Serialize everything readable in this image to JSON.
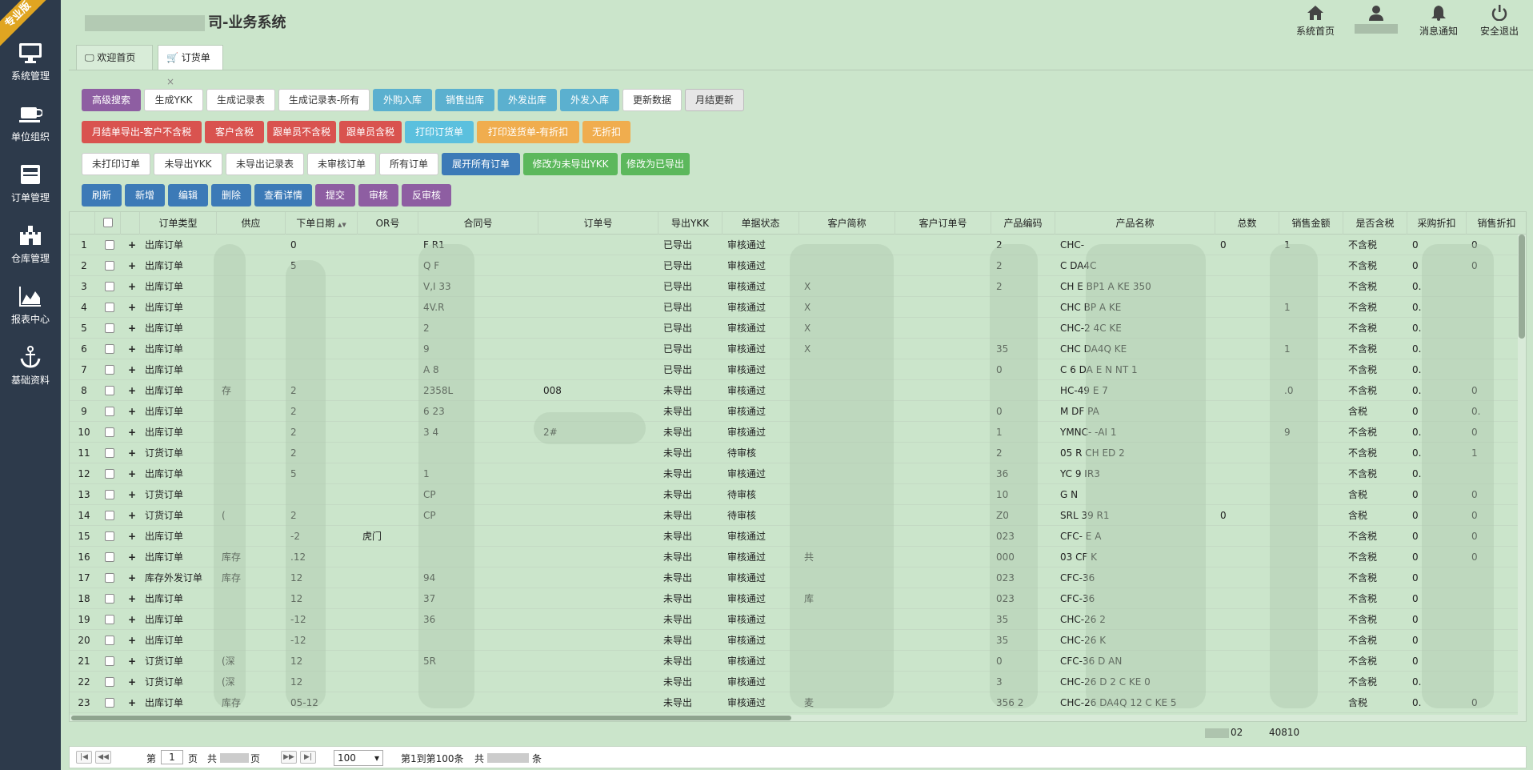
{
  "edition_ribbon": "专业版",
  "app_title": "司-业务系统",
  "sidebar": [
    {
      "label": "系统管理",
      "icon": "monitor-icon"
    },
    {
      "label": "单位组织",
      "icon": "coffee-cup-icon"
    },
    {
      "label": "订单管理",
      "icon": "inbox-icon"
    },
    {
      "label": "仓库管理",
      "icon": "castle-icon"
    },
    {
      "label": "报表中心",
      "icon": "area-chart-icon"
    },
    {
      "label": "基础资料",
      "icon": "anchor-icon"
    }
  ],
  "header": {
    "home": "系统首页",
    "messages": "消息通知",
    "logout": "安全退出"
  },
  "tabs": [
    {
      "label": "欢迎首页",
      "icon": "desktop-icon"
    },
    {
      "label": "订货单",
      "icon": "cart-icon",
      "close": "×"
    }
  ],
  "toolbar": {
    "row1": [
      "高级搜索",
      "生成YKK",
      "生成记录表",
      "生成记录表-所有",
      "外购入库",
      "销售出库",
      "外发出库",
      "外发入库",
      "更新数据",
      "月结更新"
    ],
    "row2": [
      "月结单导出-客户不含税",
      "客户含税",
      "跟单员不含税",
      "跟单员含税",
      "打印订货单",
      "打印送货单-有折扣",
      "无折扣"
    ],
    "row3": [
      "未打印订单",
      "未导出YKK",
      "未导出记录表",
      "未审核订单",
      "所有订单",
      "展开所有订单",
      "修改为未导出YKK",
      "修改为已导出"
    ],
    "row4": [
      "刷新",
      "新增",
      "编辑",
      "删除",
      "查看详情",
      "提交",
      "审核",
      "反审核"
    ]
  },
  "grid": {
    "columns": [
      "",
      "",
      "",
      "订单类型",
      "供应",
      "下单日期",
      "OR号",
      "合同号",
      "订单号",
      "导出YKK",
      "单据状态",
      "客户简称",
      "客户订单号",
      "产品编码",
      "产品名称",
      "总数",
      "销售金额",
      "是否含税",
      "采购折扣",
      "销售折扣"
    ],
    "sort_indicator": "▲▼",
    "rows": [
      {
        "n": "1",
        "type": "出库订单",
        "supplier": "",
        "date": "0",
        "or": "",
        "contract": "F R1",
        "order": "",
        "ykk": "已导出",
        "status": "审核通过",
        "cust": "",
        "cust_order": "",
        "code": "2",
        "name": "CHC-",
        "total": "0",
        "amount": "1",
        "tax": "不含税",
        "pd": "0",
        "sd": "0"
      },
      {
        "n": "2",
        "type": "出库订单",
        "supplier": "",
        "date": "5",
        "or": "",
        "contract": "Q F",
        "order": "",
        "ykk": "已导出",
        "status": "审核通过",
        "cust": "",
        "cust_order": "",
        "code": "2",
        "name": "C DA4C",
        "total": "",
        "amount": "",
        "tax": "不含税",
        "pd": "0",
        "sd": "0"
      },
      {
        "n": "3",
        "type": "出库订单",
        "supplier": "",
        "date": "",
        "or": "",
        "contract": "V,I 33",
        "order": "",
        "ykk": "已导出",
        "status": "审核通过",
        "cust": "X",
        "cust_order": "",
        "code": "2",
        "name": "CH E BP1 A KE 350",
        "total": "",
        "amount": "",
        "tax": "不含税",
        "pd": "0.",
        "sd": ""
      },
      {
        "n": "4",
        "type": "出库订单",
        "supplier": "",
        "date": "",
        "or": "",
        "contract": "4V.R",
        "order": "",
        "ykk": "已导出",
        "status": "审核通过",
        "cust": "X",
        "cust_order": "",
        "code": "",
        "name": "CHC BP A KE",
        "total": "",
        "amount": "1",
        "tax": "不含税",
        "pd": "0.",
        "sd": ""
      },
      {
        "n": "5",
        "type": "出库订单",
        "supplier": "",
        "date": "",
        "or": "",
        "contract": "2",
        "order": "",
        "ykk": "已导出",
        "status": "审核通过",
        "cust": "X",
        "cust_order": "",
        "code": "",
        "name": "CHC-2 4C KE",
        "total": "",
        "amount": "",
        "tax": "不含税",
        "pd": "0.",
        "sd": ""
      },
      {
        "n": "6",
        "type": "出库订单",
        "supplier": "",
        "date": "",
        "or": "",
        "contract": "9",
        "order": "",
        "ykk": "已导出",
        "status": "审核通过",
        "cust": "X",
        "cust_order": "",
        "code": "35",
        "name": "CHC DA4Q KE",
        "total": "",
        "amount": "1",
        "tax": "不含税",
        "pd": "0.",
        "sd": ""
      },
      {
        "n": "7",
        "type": "出库订单",
        "supplier": "",
        "date": "",
        "or": "",
        "contract": "A 8",
        "order": "",
        "ykk": "已导出",
        "status": "审核通过",
        "cust": "",
        "cust_order": "",
        "code": "0",
        "name": "C 6 DA E N NT 1",
        "total": "",
        "amount": "",
        "tax": "不含税",
        "pd": "0.",
        "sd": ""
      },
      {
        "n": "8",
        "type": "出库订单",
        "supplier": "存",
        "date": "2",
        "or": "",
        "contract": "2358L",
        "order": "008",
        "ykk": "未导出",
        "status": "审核通过",
        "cust": "",
        "cust_order": "",
        "code": "",
        "name": "HC-49 E 7",
        "total": "",
        "amount": ".0",
        "tax": "不含税",
        "pd": "0.",
        "sd": "0"
      },
      {
        "n": "9",
        "type": "出库订单",
        "supplier": "",
        "date": "2",
        "or": "",
        "contract": "6 23",
        "order": "",
        "ykk": "未导出",
        "status": "审核通过",
        "cust": "",
        "cust_order": "",
        "code": "0",
        "name": "M DF PA",
        "total": "",
        "amount": "",
        "tax": "含税",
        "pd": "0",
        "sd": "0."
      },
      {
        "n": "10",
        "type": "出库订单",
        "supplier": "",
        "date": "2",
        "or": "",
        "contract": "3 4",
        "order": "2#",
        "ykk": "未导出",
        "status": "审核通过",
        "cust": "",
        "cust_order": "",
        "code": "1",
        "name": "YMNC- -AI 1",
        "total": "",
        "amount": "9",
        "tax": "不含税",
        "pd": "0.",
        "sd": "0"
      },
      {
        "n": "11",
        "type": "订货订单",
        "supplier": "",
        "date": "2",
        "or": "",
        "contract": "",
        "order": "",
        "ykk": "未导出",
        "status": "待审核",
        "cust": "",
        "cust_order": "",
        "code": "2",
        "name": "05 R CH ED 2",
        "total": "",
        "amount": "",
        "tax": "不含税",
        "pd": "0.",
        "sd": "1"
      },
      {
        "n": "12",
        "type": "出库订单",
        "supplier": "",
        "date": "5",
        "or": "",
        "contract": "1",
        "order": "",
        "ykk": "未导出",
        "status": "审核通过",
        "cust": "",
        "cust_order": "",
        "code": "36",
        "name": "YC 9 IR3",
        "total": "",
        "amount": "",
        "tax": "不含税",
        "pd": "0.",
        "sd": ""
      },
      {
        "n": "13",
        "type": "订货订单",
        "supplier": "",
        "date": "",
        "or": "",
        "contract": "CP",
        "order": "",
        "ykk": "未导出",
        "status": "待审核",
        "cust": "",
        "cust_order": "",
        "code": "10",
        "name": "G N",
        "total": "",
        "amount": "",
        "tax": "含税",
        "pd": "0",
        "sd": "0"
      },
      {
        "n": "14",
        "type": "订货订单",
        "supplier": "(",
        "date": "2",
        "or": "",
        "contract": "CP",
        "order": "",
        "ykk": "未导出",
        "status": "待审核",
        "cust": "",
        "cust_order": "",
        "code": "Z0",
        "name": "SRL 39 R1",
        "total": "0",
        "amount": "",
        "tax": "含税",
        "pd": "0",
        "sd": "0"
      },
      {
        "n": "15",
        "type": "出库订单",
        "supplier": "",
        "date": "-2",
        "or": "虎门",
        "contract": "",
        "order": "",
        "ykk": "未导出",
        "status": "审核通过",
        "cust": "",
        "cust_order": "",
        "code": "023",
        "name": "CFC- E A",
        "total": "",
        "amount": "",
        "tax": "不含税",
        "pd": "0",
        "sd": "0"
      },
      {
        "n": "16",
        "type": "出库订单",
        "supplier": "库存",
        "date": ".12",
        "or": "",
        "contract": "",
        "order": "",
        "ykk": "未导出",
        "status": "审核通过",
        "cust": "共",
        "cust_order": "",
        "code": "000",
        "name": "03 CF K",
        "total": "",
        "amount": "",
        "tax": "不含税",
        "pd": "0",
        "sd": "0"
      },
      {
        "n": "17",
        "type": "库存外发订单",
        "supplier": "库存",
        "date": "12",
        "or": "",
        "contract": "94",
        "order": "",
        "ykk": "未导出",
        "status": "审核通过",
        "cust": "",
        "cust_order": "",
        "code": "023",
        "name": "CFC-36",
        "total": "",
        "amount": "",
        "tax": "不含税",
        "pd": "0",
        "sd": ""
      },
      {
        "n": "18",
        "type": "出库订单",
        "supplier": "",
        "date": "12",
        "or": "",
        "contract": "37",
        "order": "",
        "ykk": "未导出",
        "status": "审核通过",
        "cust": "库",
        "cust_order": "",
        "code": "023",
        "name": "CFC-36",
        "total": "",
        "amount": "",
        "tax": "不含税",
        "pd": "0",
        "sd": ""
      },
      {
        "n": "19",
        "type": "出库订单",
        "supplier": "",
        "date": "-12",
        "or": "",
        "contract": "36",
        "order": "",
        "ykk": "未导出",
        "status": "审核通过",
        "cust": "",
        "cust_order": "",
        "code": "35",
        "name": "CHC-26 2",
        "total": "",
        "amount": "",
        "tax": "不含税",
        "pd": "0",
        "sd": ""
      },
      {
        "n": "20",
        "type": "出库订单",
        "supplier": "",
        "date": "-12",
        "or": "",
        "contract": "",
        "order": "",
        "ykk": "未导出",
        "status": "审核通过",
        "cust": "",
        "cust_order": "",
        "code": "35",
        "name": "CHC-26 K",
        "total": "",
        "amount": "",
        "tax": "不含税",
        "pd": "0",
        "sd": ""
      },
      {
        "n": "21",
        "type": "订货订单",
        "supplier": "(深",
        "date": "12",
        "or": "",
        "contract": "5R",
        "order": "",
        "ykk": "未导出",
        "status": "审核通过",
        "cust": "",
        "cust_order": "",
        "code": "0",
        "name": "CFC-36 D AN",
        "total": "",
        "amount": "",
        "tax": "不含税",
        "pd": "0",
        "sd": ""
      },
      {
        "n": "22",
        "type": "订货订单",
        "supplier": "(深",
        "date": "12",
        "or": "",
        "contract": "",
        "order": "",
        "ykk": "未导出",
        "status": "审核通过",
        "cust": "",
        "cust_order": "",
        "code": "3",
        "name": "CHC-26 D 2 C KE 0",
        "total": "",
        "amount": "",
        "tax": "不含税",
        "pd": "0.",
        "sd": ""
      },
      {
        "n": "23",
        "type": "出库订单",
        "supplier": "库存",
        "date": "05-12",
        "or": "",
        "contract": "",
        "order": "",
        "ykk": "未导出",
        "status": "审核通过",
        "cust": "麦",
        "cust_order": "",
        "code": "356 2",
        "name": "CHC-26 DA4Q 12 C KE 5",
        "total": "",
        "amount": "",
        "tax": "含税",
        "pd": "0.",
        "sd": "0"
      }
    ]
  },
  "footer": {
    "total": "02",
    "amount": "40810"
  },
  "pager": {
    "page_prefix": "第",
    "page_value": "1",
    "page_suffix": "页",
    "total_pages_prefix": "共",
    "total_pages_suffix": "页",
    "page_size": "100",
    "range_text": "第1到第100条",
    "total_prefix": "共",
    "total_suffix": "条"
  },
  "colors": {
    "sidebar": "#2d3a4b",
    "background": "#cbe5cb",
    "ribbon": "#e0a521"
  }
}
